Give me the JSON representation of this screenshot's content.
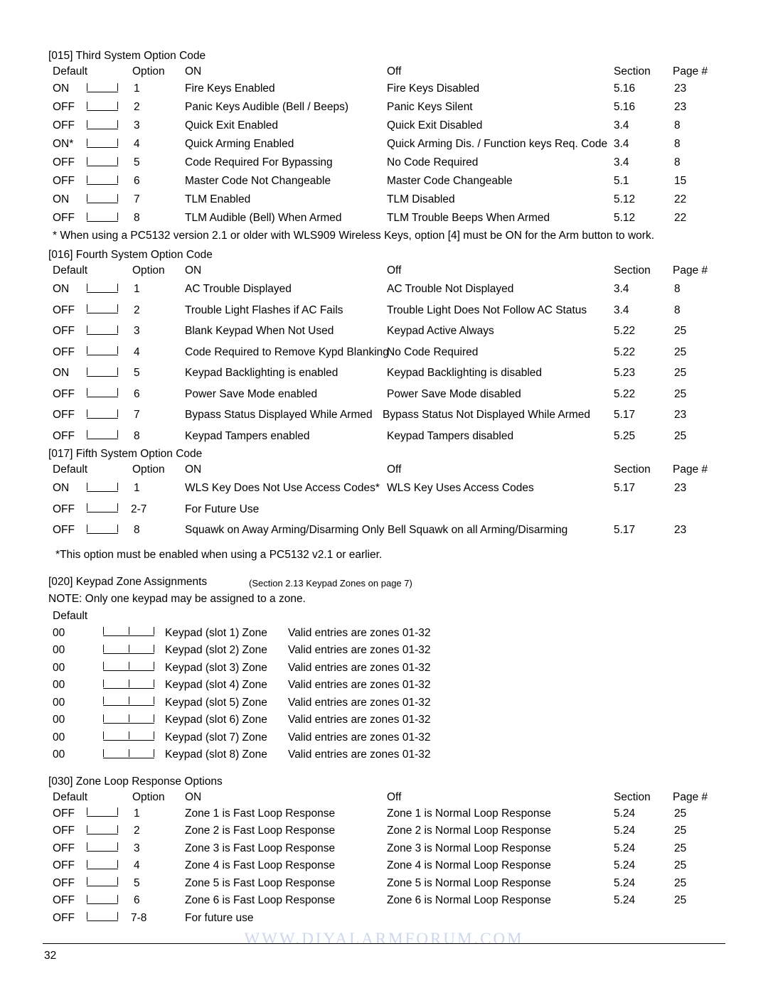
{
  "sections": [
    {
      "title": "[015] Third System Option Code",
      "headers": {
        "default": "Default",
        "option": "Option",
        "on": "ON",
        "off": "Off",
        "section": "Section",
        "page": "Page #"
      },
      "rows": [
        {
          "default": "ON",
          "option": "1",
          "on": "Fire Keys Enabled",
          "off": "Fire Keys Disabled",
          "section": "5.16",
          "page": "23"
        },
        {
          "default": "OFF",
          "option": "2",
          "on": "Panic Keys Audible (Bell / Beeps)",
          "off": "Panic Keys Silent",
          "section": "5.16",
          "page": "23"
        },
        {
          "default": "OFF",
          "option": "3",
          "on": "Quick Exit Enabled",
          "off": "Quick Exit Disabled",
          "section": "3.4",
          "page": "8"
        },
        {
          "default": "ON*",
          "option": "4",
          "on": "Quick Arming Enabled",
          "off": "Quick Arming Dis. / Function keys Req. Code",
          "section": "3.4",
          "page": "8"
        },
        {
          "default": "OFF",
          "option": "5",
          "on": "Code Required For Bypassing",
          "off": "No Code Required",
          "section": "3.4",
          "page": "8"
        },
        {
          "default": "OFF",
          "option": "6",
          "on": "Master Code Not Changeable",
          "off": "Master Code Changeable",
          "section": "5.1",
          "page": "15"
        },
        {
          "default": "ON",
          "option": "7",
          "on": "TLM Enabled",
          "off": "TLM Disabled",
          "section": "5.12",
          "page": "22"
        },
        {
          "default": "OFF",
          "option": "8",
          "on": "TLM Audible (Bell) When Armed",
          "off": "TLM Trouble Beeps When Armed",
          "section": "5.12",
          "page": "22"
        }
      ],
      "footnote": "* When using a PC5132 version 2.1 or older with WLS909 Wireless Keys, option [4] must be ON for the Arm button to work."
    },
    {
      "title": "[016] Fourth System Option Code",
      "headers": {
        "default": "Default",
        "option": "Option",
        "on": "ON",
        "off": "Off",
        "section": "Section",
        "page": "Page #"
      },
      "rows": [
        {
          "default": "ON",
          "option": "1",
          "on": "AC Trouble Displayed",
          "off": "AC Trouble Not Displayed",
          "section": "3.4",
          "page": "8"
        },
        {
          "default": "OFF",
          "option": "2",
          "on": "Trouble Light Flashes if AC Fails",
          "off": "Trouble Light Does Not Follow AC Status",
          "section": "3.4",
          "page": "8"
        },
        {
          "default": "OFF",
          "option": "3",
          "on": "Blank Keypad When Not Used",
          "off": "Keypad Active Always",
          "section": "5.22",
          "page": "25"
        },
        {
          "default": "OFF",
          "option": "4",
          "on": "Code Required to Remove Kypd Blanking",
          "off": "No Code Required",
          "section": "5.22",
          "page": "25"
        },
        {
          "default": "ON",
          "option": "5",
          "on": "Keypad Backlighting is enabled",
          "off": "Keypad Backlighting is disabled",
          "section": "5.23",
          "page": "25"
        },
        {
          "default": "OFF",
          "option": "6",
          "on": "Power Save Mode enabled",
          "off": "Power Save Mode disabled",
          "section": "5.22",
          "page": "25"
        },
        {
          "default": "OFF",
          "option": "7",
          "on": "Bypass Status Displayed While Armed",
          "off": "Bypass Status Not Displayed While Armed",
          "section": "5.17",
          "page": "23"
        },
        {
          "default": "OFF",
          "option": "8",
          "on": "Keypad Tampers enabled",
          "off": "Keypad Tampers disabled",
          "section": "5.25",
          "page": "25"
        }
      ],
      "footnote": ""
    },
    {
      "title": "[017] Fifth System Option Code",
      "headers": {
        "default": "Default",
        "option": "Option",
        "on": "ON",
        "off": "Off",
        "section": "Section",
        "page": "Page #"
      },
      "rows": [
        {
          "default": "ON",
          "option": "1",
          "on": "WLS Key Does Not Use Access Codes*",
          "off": "WLS Key Uses Access Codes",
          "section": "5.17",
          "page": "23"
        },
        {
          "default": "OFF",
          "option": "2-7",
          "on": "For Future Use",
          "off": "",
          "section": "",
          "page": ""
        },
        {
          "default": "OFF",
          "option": "8",
          "on": "Squawk on Away Arming/Disarming Only",
          "off": "Bell Squawk on all Arming/Disarming",
          "section": "5.17",
          "page": "23"
        }
      ],
      "footnote": "*This option must be enabled when using a PC5132 v2.1 or earlier."
    }
  ],
  "keypad_zone": {
    "title": "[020] Keypad Zone Assignments",
    "title_ref": "(Section 2.13  Keypad Zones   on page 7)",
    "note": "NOTE: Only one keypad may be assigned to a zone.",
    "default_label": "Default",
    "rows": [
      {
        "default": "00",
        "label": "Keypad (slot 1) Zone",
        "valid": "Valid entries are zones 01-32"
      },
      {
        "default": "00",
        "label": "Keypad (slot 2) Zone",
        "valid": "Valid entries are zones 01-32"
      },
      {
        "default": "00",
        "label": "Keypad (slot 3) Zone",
        "valid": "Valid entries are zones 01-32"
      },
      {
        "default": "00",
        "label": "Keypad (slot 4) Zone",
        "valid": "Valid entries are zones 01-32"
      },
      {
        "default": "00",
        "label": "Keypad (slot 5) Zone",
        "valid": "Valid entries are zones 01-32"
      },
      {
        "default": "00",
        "label": "Keypad (slot 6) Zone",
        "valid": "Valid entries are zones 01-32"
      },
      {
        "default": "00",
        "label": "Keypad (slot 7) Zone",
        "valid": "Valid entries are zones 01-32"
      },
      {
        "default": "00",
        "label": "Keypad (slot 8) Zone",
        "valid": "Valid entries are zones 01-32"
      }
    ]
  },
  "zone_loop": {
    "title": "[030]    Zone Loop Response Options",
    "headers": {
      "default": "Default",
      "option": "Option",
      "on": "ON",
      "off": "Off",
      "section": "Section",
      "page": "Page #"
    },
    "rows": [
      {
        "default": "OFF",
        "option": "1",
        "on": "Zone 1 is Fast Loop Response",
        "off": "Zone 1 is Normal Loop Response",
        "section": "5.24",
        "page": "25"
      },
      {
        "default": "OFF",
        "option": "2",
        "on": "Zone 2 is Fast Loop Response",
        "off": "Zone 2 is Normal Loop Response",
        "section": "5.24",
        "page": "25"
      },
      {
        "default": "OFF",
        "option": "3",
        "on": "Zone 3 is Fast Loop Response",
        "off": "Zone 3 is Normal Loop Response",
        "section": "5.24",
        "page": "25"
      },
      {
        "default": "OFF",
        "option": "4",
        "on": "Zone 4 is Fast Loop Response",
        "off": "Zone 4 is Normal Loop Response",
        "section": "5.24",
        "page": "25"
      },
      {
        "default": "OFF",
        "option": "5",
        "on": "Zone 5 is Fast Loop Response",
        "off": "Zone 5 is Normal Loop Response",
        "section": "5.24",
        "page": "25"
      },
      {
        "default": "OFF",
        "option": "6",
        "on": "Zone 6 is Fast Loop Response",
        "off": "Zone 6 is Normal Loop Response",
        "section": "5.24",
        "page": "25"
      },
      {
        "default": "OFF",
        "option": "7-8",
        "on": "For future use",
        "off": "",
        "section": "",
        "page": ""
      }
    ]
  },
  "footer": {
    "page_number": "32",
    "watermark": "WWW.DIYALARMFORUM.COM"
  }
}
